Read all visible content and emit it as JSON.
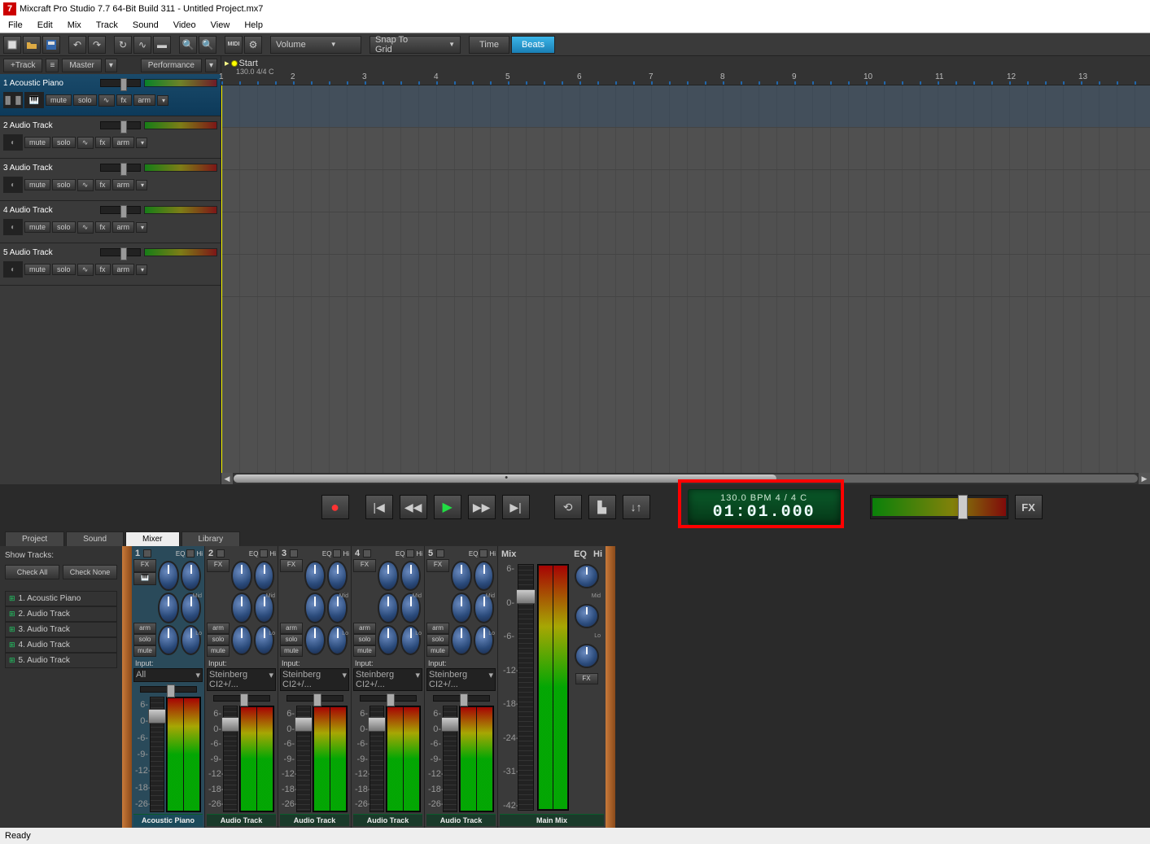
{
  "window": {
    "title": "Mixcraft Pro Studio 7.7 64-Bit Build 311 - Untitled Project.mx7"
  },
  "menu": [
    "File",
    "Edit",
    "Mix",
    "Track",
    "Sound",
    "Video",
    "View",
    "Help"
  ],
  "toolbar": {
    "volume_label": "Volume",
    "snap_label": "Snap To Grid",
    "time_label": "Time",
    "beats_label": "Beats"
  },
  "trackheader": {
    "add": "+Track",
    "master": "Master",
    "perf": "Performance"
  },
  "tracks": [
    {
      "idx": "1",
      "name": "Acoustic Piano",
      "type": "midi",
      "selected": true
    },
    {
      "idx": "2",
      "name": "Audio Track",
      "type": "audio",
      "selected": false
    },
    {
      "idx": "3",
      "name": "Audio Track",
      "type": "audio",
      "selected": false
    },
    {
      "idx": "4",
      "name": "Audio Track",
      "type": "audio",
      "selected": false
    },
    {
      "idx": "5",
      "name": "Audio Track",
      "type": "audio",
      "selected": false
    }
  ],
  "track_btns": {
    "mute": "mute",
    "solo": "solo",
    "fx": "fx",
    "arm": "arm"
  },
  "ruler": {
    "start": "Start",
    "info": "130.0 4/4 C",
    "marks": [
      "1",
      "2",
      "3",
      "4",
      "5",
      "6",
      "7",
      "8",
      "9",
      "10",
      "11",
      "12",
      "13"
    ]
  },
  "transport": {
    "bpm_line": "130.0 BPM   4 / 4    C",
    "time": "01:01.000"
  },
  "bottom_tabs": [
    "Project",
    "Sound",
    "Mixer",
    "Library"
  ],
  "bottom_tabs_active": 2,
  "mixer_side": {
    "show": "Show Tracks:",
    "checkall": "Check All",
    "checknone": "Check None",
    "list": [
      "1. Acoustic Piano",
      "2. Audio Track",
      "3. Audio Track",
      "4. Audio Track",
      "5. Audio Track"
    ]
  },
  "channel_labels": {
    "eq": "EQ",
    "hi": "Hi",
    "mid": "Mid",
    "lo": "Lo",
    "fx": "FX",
    "arm": "arm",
    "solo": "solo",
    "mute": "mute",
    "input": "Input:",
    "all": "All",
    "stein": "Steinberg CI2+/...",
    "mainmix": "Main Mix"
  },
  "channels": [
    {
      "num": "1",
      "name": "Acoustic Piano",
      "input": "All",
      "selected": true,
      "type": "midi"
    },
    {
      "num": "2",
      "name": "Audio Track",
      "input": "Steinberg CI2+/...",
      "selected": false,
      "type": "audio"
    },
    {
      "num": "3",
      "name": "Audio Track",
      "input": "Steinberg CI2+/...",
      "selected": false,
      "type": "audio"
    },
    {
      "num": "4",
      "name": "Audio Track",
      "input": "Steinberg CI2+/...",
      "selected": false,
      "type": "audio"
    },
    {
      "num": "5",
      "name": "Audio Track",
      "input": "Steinberg CI2+/...",
      "selected": false,
      "type": "audio"
    }
  ],
  "fader_scale": [
    "6-",
    "0-",
    "-6-",
    "-9-",
    "-12-",
    "-18-",
    "-26-"
  ],
  "mix_scale": [
    "6-",
    "0-",
    "-6-",
    "-12-",
    "-18-",
    "-24-",
    "-31-",
    "-42-"
  ],
  "status": "Ready"
}
